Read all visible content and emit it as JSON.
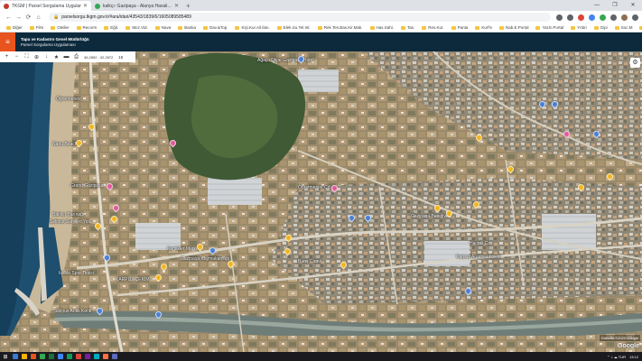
{
  "browser": {
    "tabs": [
      {
        "title": "TKGM | Parsel Sorgulama Uygulama",
        "favicon_color": "#c0392b",
        "active": true
      },
      {
        "title": "kalkçı: Gazipaşa - Alanya Havali...",
        "favicon_color": "#34a853",
        "active": false
      }
    ],
    "new_tab": "+",
    "window_controls": [
      "—",
      "❐",
      "✕"
    ],
    "url": "parselsorgu.tkgm.gov.tr/#ara/idari/43543/1839/6/1605089585489",
    "nav": {
      "back": "←",
      "forward": "→",
      "reload": "⟳",
      "home": "⌂"
    },
    "bookmarks": [
      "Diğer",
      "Film",
      "Oteller",
      "Recorm",
      "Eğit.",
      "Moz.Vid.",
      "Nava",
      "Banka",
      "Dav.&Top.",
      "Kişi.Kur.Ail.Ilan.",
      "Elek.Su.Tel.Int.",
      "Rek.Tes.Bas.Kir.Mak.",
      "Has.Sahi.",
      "Tas.",
      "Res.Kur.",
      "Panta",
      "Kurf'e",
      "Nab.E.Portal",
      "Yat.E.Portal",
      "Ynbri",
      "Gipi",
      "Soc.M",
      "gearvisor"
    ]
  },
  "app": {
    "menu_icon": "≡",
    "title_line1": "Tapu ve Kadastro Genel Müdürlüğü",
    "title_line2": "Parsel Sorgulama Uygulaması"
  },
  "map_toolbar": {
    "tools": [
      "+",
      "−",
      "⛶",
      "⊕",
      "↓",
      "★",
      "▬",
      "⎙"
    ],
    "coordinates": "36.2892 : 32.2872",
    "zoom": "15"
  },
  "map": {
    "labels": [
      "Ağaçlı Diyar Gazipaşa Hotel",
      "Öğretmenevi",
      "Nanu Beach",
      "Grand Gazipaşa",
      "Balıkçı Barınağı",
      "Selinus Sahilleri Yolu",
      "Iskele Spor Tesisi",
      "KARPUZ ÇEKİM",
      "Selinus Antik Kenti",
      "Kemikler Market",
      "Gazipaşa Kaymakamlığı",
      "Barış Camii",
      "Gazipaşa Belediyesi",
      "Hacıali Cd.",
      "Karpuz Anadolu Lisesi",
      "Öğretmenler Cd."
    ],
    "attribution": "Görüntü ©2020 Google",
    "logo": "Google"
  },
  "taskbar": {
    "start_icon": "⊞",
    "apps": [
      "#3a7bd5",
      "#f4b400",
      "#e8541e",
      "#34a853",
      "#1f6f3d",
      "#4285f4",
      "#0f9d58",
      "#db4437",
      "#7b1fa2",
      "#00acc1",
      "#ff7043",
      "#5c6bc0"
    ],
    "time": "13:12",
    "tray_icons": "⌃ ♪ ☁ TUR"
  },
  "colors": {
    "header_bg": "#0d2a3d",
    "accent_orange": "#e8541e",
    "pin_yellow": "#f2b51c",
    "pin_pink": "#e05a9c",
    "pin_blue": "#4a7fd6"
  }
}
